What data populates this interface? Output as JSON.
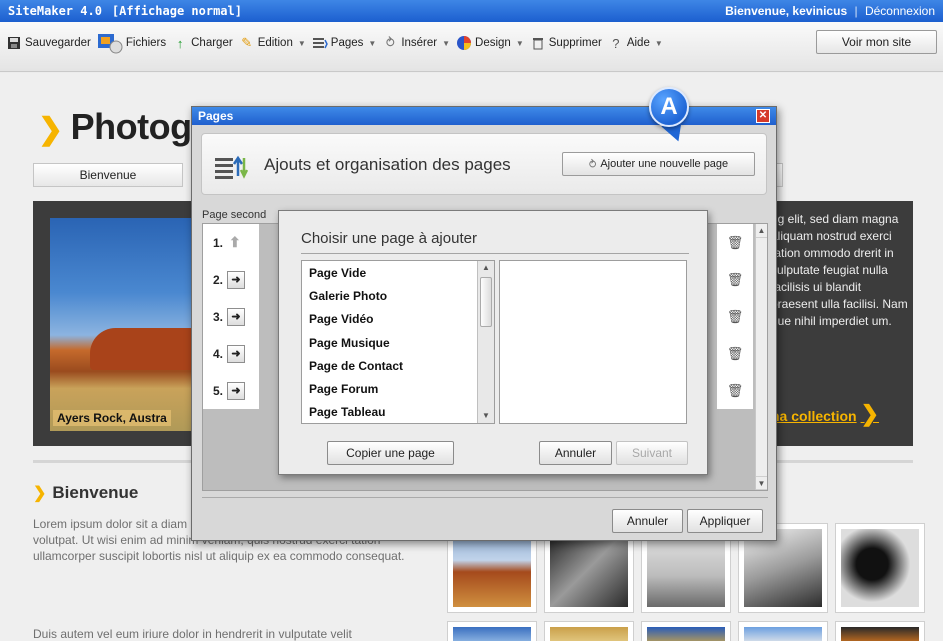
{
  "app": {
    "title": "SiteMaker 4.0",
    "mode": "[Affichage normal]",
    "welcome": "Bienvenue, kevinicus",
    "separator": "|",
    "logout": "Déconnexion"
  },
  "toolbar": {
    "items": [
      {
        "label": "Sauvegarder",
        "icon": "save-icon",
        "dropdown": false
      },
      {
        "label": "Fichiers",
        "icon": "files-icon",
        "dropdown": false
      },
      {
        "label": "Charger",
        "icon": "upload-arrow-icon",
        "dropdown": false
      },
      {
        "label": "Edition",
        "icon": "pencil-icon",
        "dropdown": true
      },
      {
        "label": "Pages",
        "icon": "pages-icon",
        "dropdown": true
      },
      {
        "label": "Insérer",
        "icon": "insert-icon",
        "dropdown": true
      },
      {
        "label": "Design",
        "icon": "palette-icon",
        "dropdown": true
      },
      {
        "label": "Supprimer",
        "icon": "trash-icon",
        "dropdown": false
      },
      {
        "label": "Aide",
        "icon": "help-icon",
        "dropdown": true
      }
    ],
    "view_site_label": "Voir mon site"
  },
  "site": {
    "title": "Photogr",
    "tab_home": "Bienvenue",
    "hero_caption": "Ayers Rock, Austra",
    "hero_text": "ng elit, sed diam magna aliquam nostrud exerci tation ommodo drerit in vulputate feugiat nulla facilisis ui blandit praesent ulla facilisi. Nam gue nihil imperdiet um.",
    "hero_link": "na collection",
    "section_title": "Bienvenue",
    "paragraph1": "Lorem ipsum dolor sit a diam nonummy nibh eu magna aliquam erat volutpat. Ut wisi enim ad minim veniam, quis nostrud exerci tation ullamcorper suscipit lobortis nisl ut aliquip ex ea commodo consequat.",
    "paragraph2": "Duis autem vel eum iriure dolor in hendrerit in vulputate velit"
  },
  "pages_dialog": {
    "title": "Pages",
    "header_title": "Ajouts et organisation des pages",
    "add_page_label": "Ajouter une nouvelle page",
    "subheading": "Page second",
    "rows": [
      "1.",
      "2.",
      "3.",
      "4.",
      "5."
    ],
    "cancel_label": "Annuler",
    "apply_label": "Appliquer"
  },
  "choose_dialog": {
    "title": "Choisir une page à ajouter",
    "page_types": [
      "Page Vide",
      "Galerie Photo",
      "Page Vidéo",
      "Page Musique",
      "Page de Contact",
      "Page Forum",
      "Page Tableau"
    ],
    "copy_label": "Copier une page",
    "cancel_label": "Annuler",
    "next_label": "Suivant"
  },
  "callout": {
    "letter": "A"
  },
  "colors": {
    "title_bar": "#1f5fce",
    "accent_yellow": "#f6b400",
    "dialog_bg": "#d8d8d8"
  }
}
